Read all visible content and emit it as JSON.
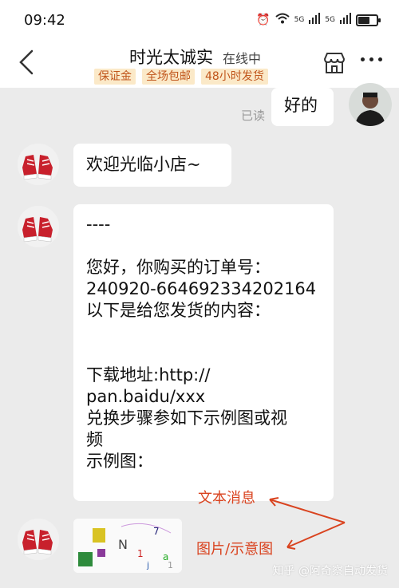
{
  "status_bar": {
    "time": "09:42",
    "signal_1": "5G",
    "signal_2": "5G",
    "battery_level": 0.65
  },
  "header": {
    "title": "时光太诚实",
    "status": "在线中",
    "badges": [
      "保证金",
      "全场包邮",
      "48小时发货"
    ]
  },
  "messages": {
    "mine": {
      "text": "好的",
      "read_label": "已读"
    },
    "welcome": {
      "text": "欢迎光临小店~"
    },
    "order": {
      "lines": [
        "----",
        "",
        "您好，你购买的订单号：",
        "240920-664692334202164",
        "以下是给您发货的内容：",
        "",
        "",
        "下载地址:http://",
        "pan.baidu/xxx",
        "兑换步骤参如下示例图或视",
        "频",
        "示例图："
      ]
    }
  },
  "annotations": {
    "text_message": "文本消息",
    "image_message": "图片/示意图"
  },
  "watermark": "知乎 @阿奇察自动发货",
  "colors": {
    "annotation": "#d9431f",
    "badge_bg": "#fbe9c8",
    "badge_text": "#c0551b"
  }
}
